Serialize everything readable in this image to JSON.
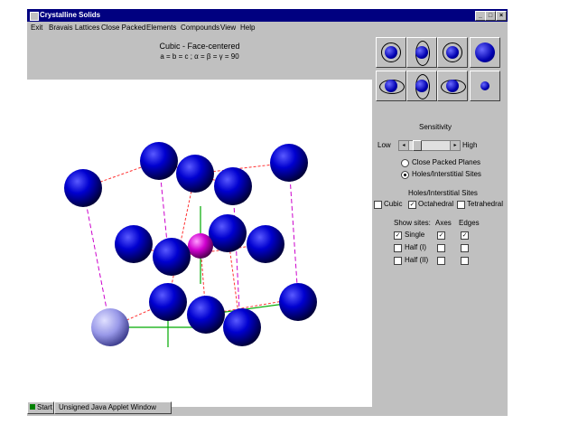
{
  "window": {
    "title": "Crystalline Solids",
    "minimize": "_",
    "maximize": "□",
    "close": "×"
  },
  "menu": [
    "Exit",
    "Bravais Lattices",
    "Close Packed",
    "Elements",
    "Compounds",
    "View",
    "Help"
  ],
  "heading": {
    "title": "Cubic - Face-centered",
    "params": "a = b = c ; α = β = γ = 90"
  },
  "sensitivity": {
    "label": "Sensitivity",
    "low": "Low",
    "high": "High",
    "level": 0.15
  },
  "mode": {
    "options": [
      "Close Packed Planes",
      "Holes/Interstitial Sites"
    ],
    "selected": 1
  },
  "holes": {
    "label": "Holes/Interstitial Sites",
    "items": [
      {
        "label": "Cubic",
        "checked": false
      },
      {
        "label": "Octahedral",
        "checked": true
      },
      {
        "label": "Tetrahedral",
        "checked": false
      }
    ]
  },
  "table": {
    "headers": [
      "Show sites:",
      "Axes",
      "Edges"
    ],
    "rows": [
      {
        "label": "Single",
        "show": true,
        "axes": true,
        "edges": true
      },
      {
        "label": "Half (I)",
        "show": false,
        "axes": false,
        "edges": false
      },
      {
        "label": "Half (II)",
        "show": false,
        "axes": false,
        "edges": false
      }
    ]
  },
  "statusbar": {
    "start_label": "Start",
    "warning": "Unsigned Java Applet Window"
  },
  "colors": {
    "atom": "#0000cc",
    "hole_site": "#cc00cc",
    "origin_atom": "#a0a0f0",
    "edge_dash": "#cc00cc",
    "bond": "#ff3333",
    "axis": "#00aa00"
  }
}
